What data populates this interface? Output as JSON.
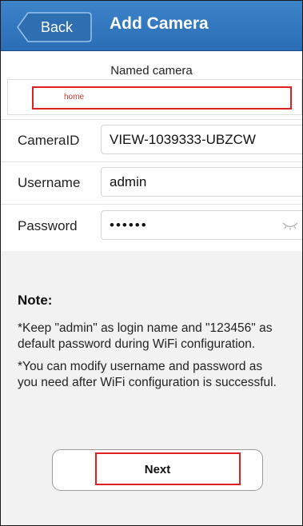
{
  "header": {
    "back_label": "Back",
    "title": "Add Camera",
    "bg_color": "#2f74bd"
  },
  "form": {
    "named_camera_label": "Named camera",
    "camera_name_value": "home",
    "camera_id_label": "CameraID",
    "camera_id_value": "VIEW-1039333-UBZCW",
    "username_label": "Username",
    "username_value": "admin",
    "password_label": "Password",
    "password_value": "••••••",
    "highlight_color": "#e02020"
  },
  "note": {
    "title": "Note:",
    "line1a": "*Keep \"admin\" as login name and \"123456\" as",
    "line1b": "default password during WiFi configuration.",
    "line2a": "*You can modify username and password as",
    "line2b": "you need after WiFi configuration is successful."
  },
  "actions": {
    "next_label": "Next"
  },
  "icons": {
    "password_toggle": "eye-closed-icon"
  }
}
